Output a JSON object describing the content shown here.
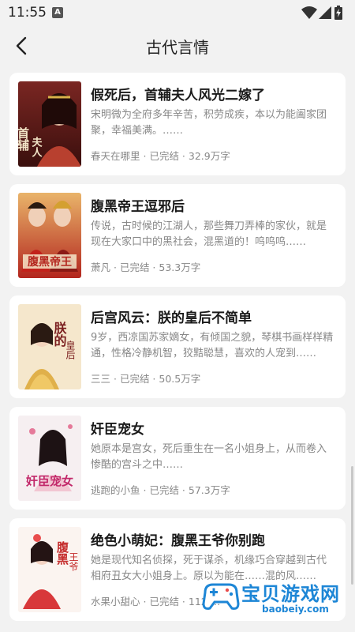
{
  "status_bar": {
    "time": "11:55",
    "notification_badge": "A"
  },
  "header": {
    "title": "古代言情",
    "back_icon": "chevron-left-icon"
  },
  "books": [
    {
      "title": "假死后，首辅夫人风光二嫁了",
      "description": "宋明微为全府多年辛苦，积劳成疾，本以为能阖家团聚，幸福美满。……",
      "author": "春天在哪里",
      "status": "已完结",
      "word_count": "32.9万字",
      "cover_text": "首辅夫人",
      "cover_colors": [
        "#6b1f1c",
        "#c98a6e"
      ]
    },
    {
      "title": "腹黑帝王逗邪后",
      "description": "传说，古时候的江湖人，那些舞刀弄棒的家伙，就是现在大家口中的黑社会，混黑道的！呜呜呜……",
      "author": "萧凡",
      "status": "已完结",
      "word_count": "53.3万字",
      "cover_text": "腹黑帝王",
      "cover_colors": [
        "#b3261e",
        "#e8a44a"
      ]
    },
    {
      "title": "后宫风云：朕的皇后不简单",
      "description": "9岁，西凉国苏家嫡女，有倾国之貌，琴棋书画样样精通，性格冷静机智，狡黠聪慧，喜欢的人宠到……",
      "author": "三三",
      "status": "已完结",
      "word_count": "50.5万字",
      "cover_text": "朕的皇后不简单",
      "cover_colors": [
        "#f3e2c4",
        "#d9a34a"
      ]
    },
    {
      "title": "奸臣宠女",
      "description": "她原本是宫女，死后重生在一名小姐身上，从而卷入惨酷的宫斗之中……",
      "author": "逃跑的小鱼",
      "status": "已完结",
      "word_count": "57.3万字",
      "cover_text": "奸臣宠女",
      "cover_colors": [
        "#f4eef0",
        "#d0507a"
      ]
    },
    {
      "title": "绝色小萌妃：腹黑王爷你别跑",
      "description": "她是现代知名侦探，死于谋杀，机缘巧合穿越到古代相府丑女大小姐身上。原以为能在……混的风……",
      "author": "水果小甜心",
      "status": "已完结",
      "word_count": "112.…",
      "cover_text": "腹黑王爷",
      "cover_colors": [
        "#faf3f0",
        "#d23a3a"
      ]
    }
  ],
  "watermark": {
    "text": "宝贝游戏网",
    "url": "baobeiy.com"
  }
}
